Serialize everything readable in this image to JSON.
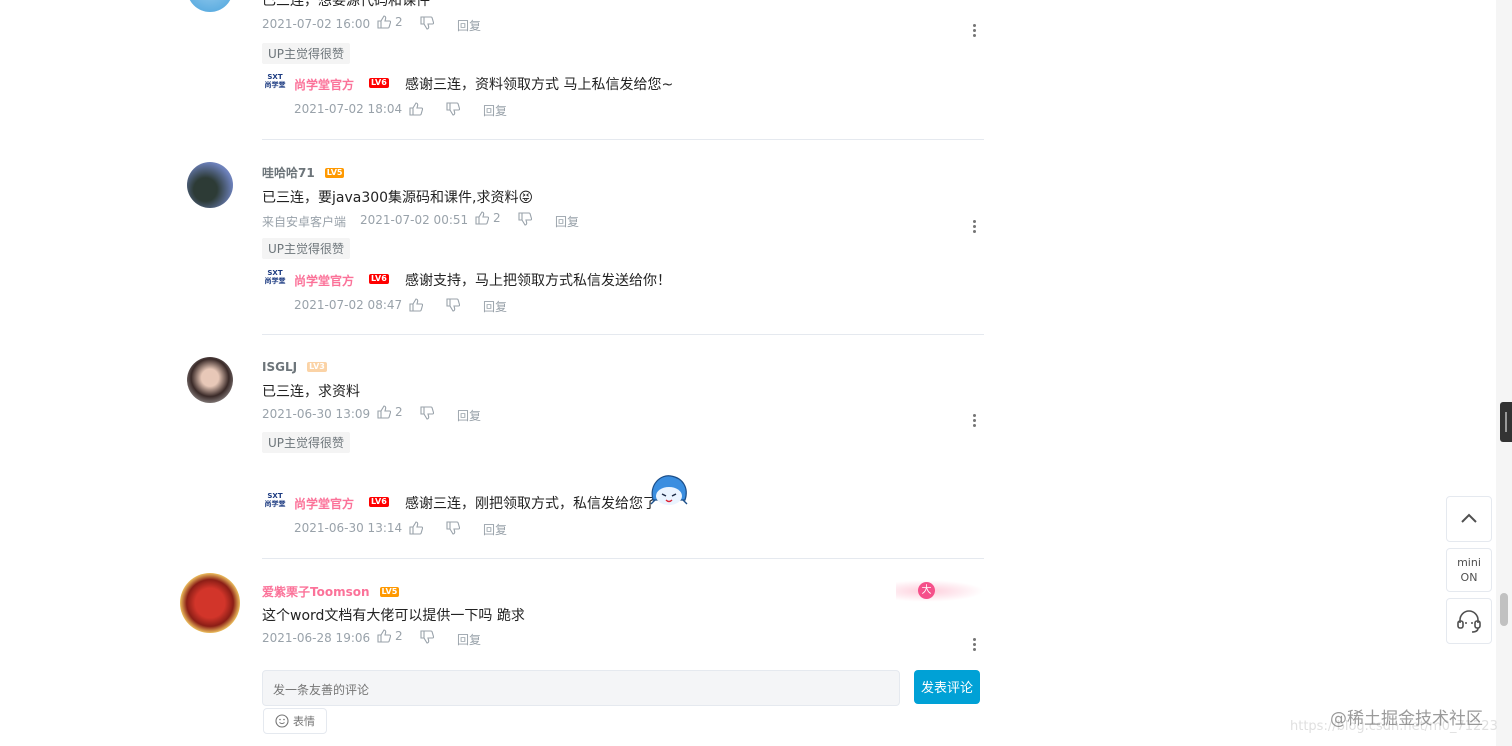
{
  "comments": [
    {
      "text": "已三连，想要源代码和课件",
      "date": "2021-07-02 16:00",
      "likes": "2",
      "reply_label": "回复",
      "tag": "UP主觉得很赞",
      "reply": {
        "user": "尚学堂官方",
        "level": "LV6",
        "text": "感谢三连，资料领取方式 马上私信发给您~",
        "date": "2021-07-02 18:04",
        "reply_label": "回复"
      }
    },
    {
      "user": "哇哈哈71",
      "level": "LV5",
      "text": "已三连，要java300集源码和课件,求资料",
      "emoji": "😝",
      "source": "来自安卓客户端",
      "date": "2021-07-02 00:51",
      "likes": "2",
      "reply_label": "回复",
      "tag": "UP主觉得很赞",
      "reply": {
        "user": "尚学堂官方",
        "level": "LV6",
        "text": "感谢支持，马上把领取方式私信发送给你！",
        "date": "2021-07-02 08:47",
        "reply_label": "回复"
      }
    },
    {
      "user": "ISGLJ",
      "level": "LV3",
      "text": "已三连，求资料",
      "date": "2021-06-30 13:09",
      "likes": "2",
      "reply_label": "回复",
      "tag": "UP主觉得很赞",
      "reply": {
        "user": "尚学堂官方",
        "level": "LV6",
        "text": "感谢三连，刚把领取方式，私信发给您了",
        "date": "2021-06-30 13:14",
        "reply_label": "回复"
      }
    },
    {
      "user": "爱紫栗子Toomson",
      "level": "LV5",
      "text": "这个word文档有大佬可以提供一下吗 跪求",
      "date": "2021-06-28 19:06",
      "likes": "2",
      "reply_label": "回复",
      "badge": "大"
    }
  ],
  "reply_logo": "SXT 尚学堂",
  "composer": {
    "placeholder": "发一条友善的评论",
    "submit_label": "发表评论",
    "emoji_label": "表情"
  },
  "sidebar": {
    "mini_line1": "mini",
    "mini_line2": "ON"
  },
  "watermark": "@稀土掘金技术社区",
  "watermark_url": "https://blog.csdn.net/m0_71223",
  "colors": {
    "accent": "#00a1d6",
    "pink": "#fb7299",
    "meta": "#99a2aa"
  }
}
